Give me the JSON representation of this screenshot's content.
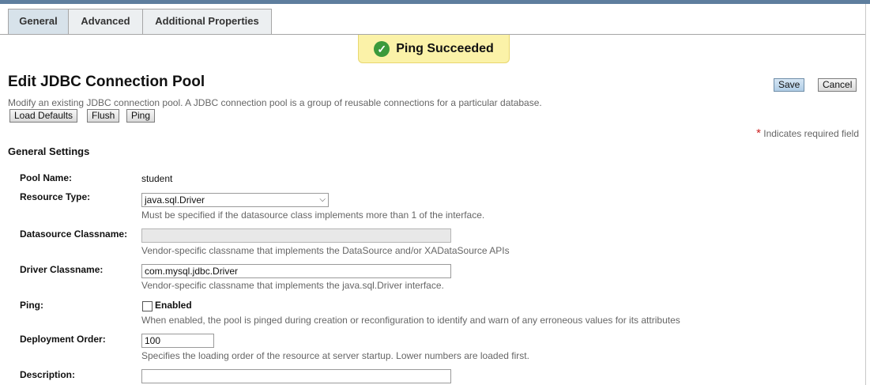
{
  "tabs": [
    "General",
    "Advanced",
    "Additional Properties"
  ],
  "message": {
    "text": "Ping Succeeded",
    "icon": "check-circle-icon",
    "color": "#3b9a3b"
  },
  "page": {
    "title": "Edit JDBC Connection Pool",
    "help": "Modify an existing JDBC connection pool. A JDBC connection pool is a group of reusable connections for a particular database."
  },
  "actions": {
    "load_defaults": "Load Defaults",
    "flush": "Flush",
    "ping": "Ping",
    "save": "Save",
    "cancel": "Cancel"
  },
  "required_note": {
    "star": "*",
    "text": "Indicates required field"
  },
  "section_title": "General Settings",
  "fields": {
    "pool_name": {
      "label": "Pool Name:",
      "value": "student"
    },
    "resource_type": {
      "label": "Resource Type:",
      "value": "java.sql.Driver",
      "hint": "Must be specified if the datasource class implements more than 1 of the interface."
    },
    "datasource_classname": {
      "label": "Datasource Classname:",
      "value": "",
      "hint": "Vendor-specific classname that implements the DataSource and/or XADataSource APIs"
    },
    "driver_classname": {
      "label": "Driver Classname:",
      "value": "com.mysql.jdbc.Driver",
      "hint": "Vendor-specific classname that implements the java.sql.Driver interface."
    },
    "ping": {
      "label": "Ping:",
      "checkbox_label": "Enabled",
      "checked": false,
      "hint": "When enabled, the pool is pinged during creation or reconfiguration to identify and warn of any erroneous values for its attributes"
    },
    "deployment_order": {
      "label": "Deployment Order:",
      "value": "100",
      "hint": "Specifies the loading order of the resource at server startup. Lower numbers are loaded first."
    },
    "description": {
      "label": "Description:",
      "value": ""
    }
  }
}
